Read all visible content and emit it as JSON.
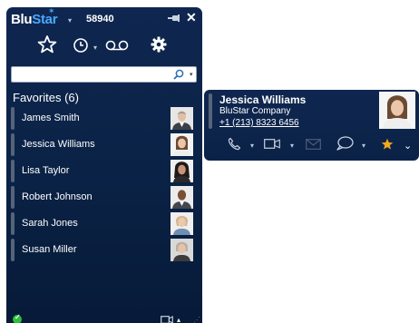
{
  "window": {
    "brand": {
      "part1": "Blu",
      "part2": "Star",
      "caret": "▾"
    },
    "extension": "58940",
    "icons": {
      "pin": "pin-icon",
      "close": "close-icon"
    }
  },
  "toolbar": {
    "favorites": "star-icon",
    "history": "clock-icon",
    "voicemail": "voicemail-icon",
    "settings": "gear-icon"
  },
  "search": {
    "value": "",
    "placeholder": "",
    "icon": "search-icon"
  },
  "favorites": {
    "heading": "Favorites (6)",
    "contacts": [
      {
        "name": "James Smith"
      },
      {
        "name": "Jessica Williams"
      },
      {
        "name": "Lisa Taylor"
      },
      {
        "name": "Robert Johnson"
      },
      {
        "name": "Sarah Jones"
      },
      {
        "name": "Susan Miller"
      }
    ]
  },
  "footer": {
    "status": "available",
    "icons": [
      "video-icon",
      "chevron-up-icon",
      "resize-grip-icon"
    ]
  },
  "card": {
    "name": "Jessica Williams",
    "company": "BluStar Company",
    "phone": "+1 (213) 8323 6456",
    "actions": [
      "phone-icon",
      "video-icon",
      "email-icon",
      "chat-icon",
      "star-icon",
      "chevron-down-icon"
    ]
  },
  "colors": {
    "background": "#0b2247",
    "accent": "#4aa8ff",
    "favorite_star": "#f4a81d",
    "status_available": "#2ebf3a"
  }
}
